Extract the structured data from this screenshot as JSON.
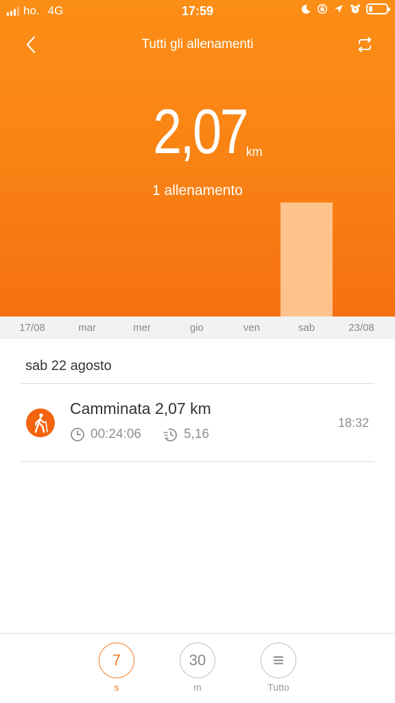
{
  "status_bar": {
    "carrier": "ho.",
    "network": "4G",
    "time": "17:59"
  },
  "header": {
    "title": "Tutti gli allenamenti"
  },
  "summary": {
    "total_value": "2,07",
    "total_unit": "km",
    "workouts_label": "1 allenamento"
  },
  "chart_data": {
    "type": "bar",
    "categories": [
      "17/08",
      "mar",
      "mer",
      "gio",
      "ven",
      "sab",
      "23/08"
    ],
    "values": [
      0,
      0,
      0,
      0,
      0,
      2.07,
      0
    ],
    "ylabel": "km"
  },
  "day_labels": [
    "17/08",
    "mar",
    "mer",
    "gio",
    "ven",
    "sab",
    "23/08"
  ],
  "list": {
    "date_header": "sab 22 agosto",
    "workouts": [
      {
        "title": "Camminata 2,07 km",
        "duration": "00:24:06",
        "pace": "5,16",
        "time": "18:32"
      }
    ]
  },
  "tabs": [
    {
      "value": "7",
      "label": "s",
      "active": true
    },
    {
      "value": "30",
      "label": "m",
      "active": false
    },
    {
      "value": "≡",
      "label": "Tutto",
      "active": false
    }
  ],
  "colors": {
    "accent": "#f57a22",
    "header_top": "#fb8e17",
    "header_bottom": "#f57012",
    "bar": "#ffc28c"
  }
}
